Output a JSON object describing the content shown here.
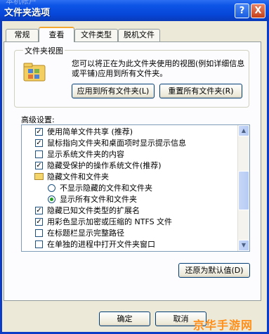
{
  "window": {
    "title": "文件夹选项",
    "ghost_title": "本机帐户",
    "help_label": "?",
    "close_label": "X"
  },
  "tabs": [
    {
      "label": "常规",
      "active": false
    },
    {
      "label": "查看",
      "active": true
    },
    {
      "label": "文件类型",
      "active": false
    },
    {
      "label": "脱机文件",
      "active": false
    }
  ],
  "folder_views": {
    "title": "文件夹视图",
    "description": "您可以将正在为此文件夹使用的视图(例如详细信息或平铺)应用到所有文件夹。",
    "apply_all_label": "应用到所有文件夹(L)",
    "reset_all_label": "重置所有文件夹(R)"
  },
  "advanced": {
    "label": "高级设置:",
    "items": [
      {
        "type": "checkbox",
        "checked": true,
        "label": "使用简单文件共享 (推荐)"
      },
      {
        "type": "checkbox",
        "checked": true,
        "label": "鼠标指向文件夹和桌面项时显示提示信息"
      },
      {
        "type": "checkbox",
        "checked": false,
        "label": "显示系统文件夹的内容"
      },
      {
        "type": "checkbox",
        "checked": true,
        "label": "隐藏受保护的操作系统文件(推荐)"
      },
      {
        "type": "folder",
        "label": "隐藏文件和文件夹"
      },
      {
        "type": "radio",
        "checked": false,
        "label": "不显示隐藏的文件和文件夹"
      },
      {
        "type": "radio",
        "checked": true,
        "label": "显示所有文件和文件夹"
      },
      {
        "type": "checkbox",
        "checked": true,
        "label": "隐藏已知文件类型的扩展名"
      },
      {
        "type": "checkbox",
        "checked": true,
        "label": "用彩色显示加密或压缩的 NTFS 文件"
      },
      {
        "type": "checkbox",
        "checked": false,
        "label": "在标题栏显示完整路径"
      },
      {
        "type": "checkbox",
        "checked": false,
        "label": "在单独的进程中打开文件夹窗口"
      }
    ],
    "restore_label": "还原为默认值(D)"
  },
  "footer": {
    "ok_label": "确定",
    "cancel_label": "取消"
  },
  "watermark": "京华手游网",
  "colors": {
    "titlebar": "#0646d8",
    "dialog_bg": "#ece9d8",
    "panel_bg": "#fcfcfe",
    "active_tab_accent": "#f4a92e",
    "check": "#21a121"
  }
}
